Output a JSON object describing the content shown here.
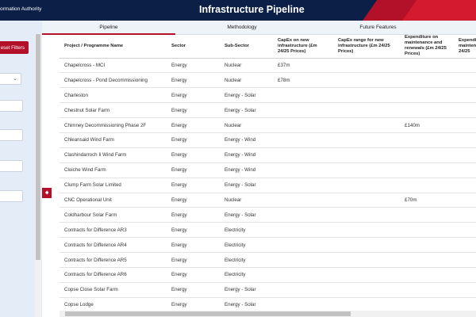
{
  "header": {
    "org_text": "ormation Authority",
    "title": "Infrastructure Pipeline"
  },
  "filters": {
    "reset_label": "eset Filters"
  },
  "tabs": [
    {
      "label": "Pipeline",
      "active": true
    },
    {
      "label": "Methodology",
      "active": false
    },
    {
      "label": "Future Features",
      "active": false
    }
  ],
  "table": {
    "columns": [
      "Project / Programme Name",
      "Sector",
      "Sub-Sector",
      "CapEx on new infrastructure (£m 24/25 Prices)",
      "CapEx range for new infrastructure (£m 24/25 Prices)",
      "Expenditure on maintenance and renewals (£m 24/25 Prices)",
      "Expenditu maintenanc (£m 24/25"
    ],
    "rows": [
      [
        "Chapelcross - MCI",
        "Energy",
        "Nuclear",
        "£37m",
        "",
        "",
        ""
      ],
      [
        "Chapelcross - Pond Decommissioning",
        "Energy",
        "Nuclear",
        "£78m",
        "",
        "",
        ""
      ],
      [
        "Charleston",
        "Energy",
        "Energy - Solar",
        "",
        "",
        "",
        ""
      ],
      [
        "Chestnut Solar Farm",
        "Energy",
        "Energy - Solar",
        "",
        "",
        "",
        ""
      ],
      [
        "Chimney Decommissioning Phase 2F",
        "Energy",
        "Nuclear",
        "",
        "",
        "£140m",
        ""
      ],
      [
        "Chleansaid Wind Farm",
        "Energy",
        "Energy - Wind",
        "",
        "",
        "",
        ""
      ],
      [
        "Clashindarroch Ii Wind Farm",
        "Energy",
        "Energy - Wind",
        "",
        "",
        "",
        ""
      ],
      [
        "Cloiche Wind Farm",
        "Energy",
        "Energy - Wind",
        "",
        "",
        "",
        ""
      ],
      [
        "Clump Farm Solar Limited",
        "Energy",
        "Energy - Solar",
        "",
        "",
        "",
        ""
      ],
      [
        "CNC Operational Unit",
        "Energy",
        "Nuclear",
        "",
        "",
        "£70m",
        ""
      ],
      [
        "Coldharbour Solar Farm",
        "Energy",
        "Energy - Solar",
        "",
        "",
        "",
        ""
      ],
      [
        "Contracts for Difference AR3",
        "Energy",
        "Electricity",
        "",
        "",
        "",
        ""
      ],
      [
        "Contracts for Difference AR4",
        "Energy",
        "Electricity",
        "",
        "",
        "",
        ""
      ],
      [
        "Contracts for Difference AR5",
        "Energy",
        "Electricity",
        "",
        "",
        "",
        ""
      ],
      [
        "Contracts for Difference AR6",
        "Energy",
        "Electricity",
        "",
        "",
        "",
        ""
      ],
      [
        "Copse Close Solar Farm",
        "Energy",
        "Energy - Solar",
        "",
        "",
        "",
        ""
      ],
      [
        "Copse Lodge",
        "Energy",
        "Energy - Solar",
        "",
        "",
        "",
        ""
      ]
    ]
  },
  "colors": {
    "header_bg": "#0b1f47",
    "accent_red": "#b3102a",
    "panel_bg": "#e4edf7"
  }
}
